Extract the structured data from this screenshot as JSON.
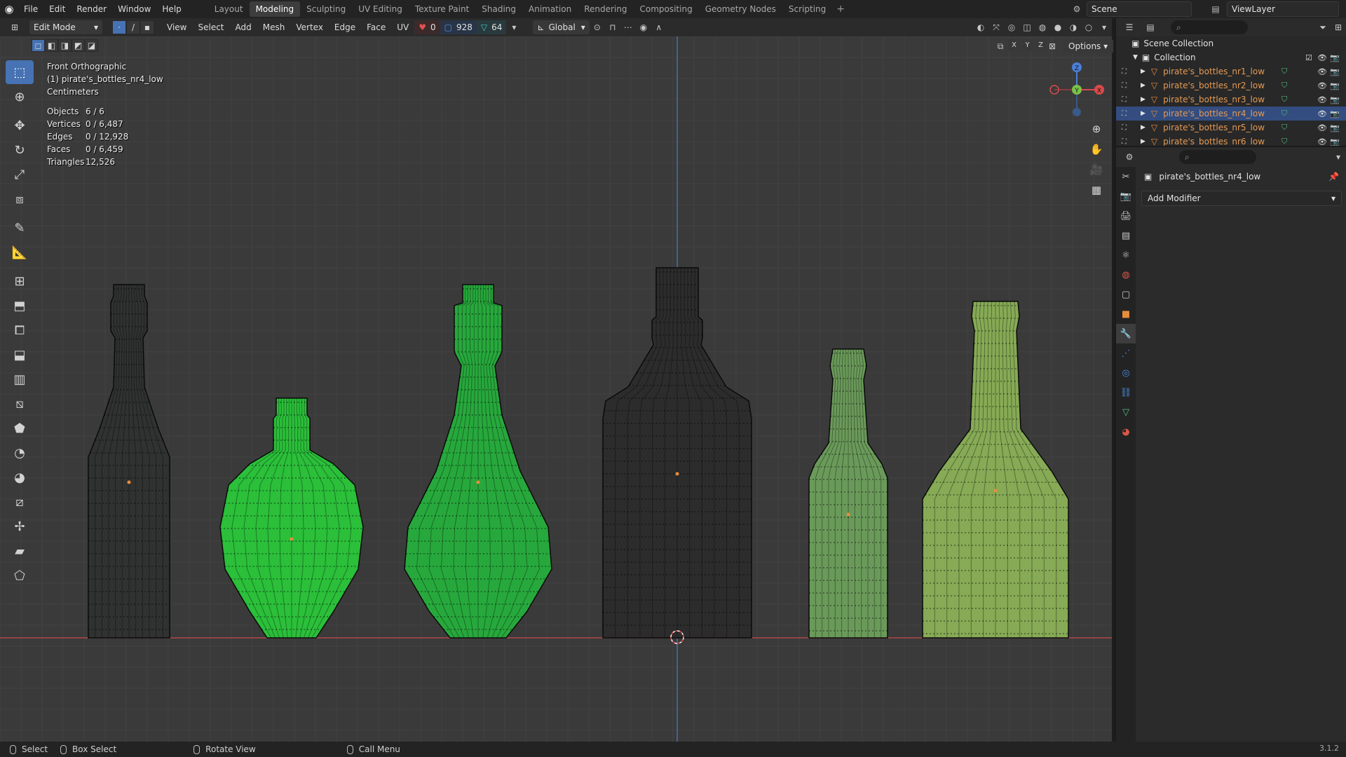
{
  "topbar": {
    "menus": [
      "File",
      "Edit",
      "Render",
      "Window",
      "Help"
    ],
    "workspaces": [
      "Layout",
      "Modeling",
      "Sculpting",
      "UV Editing",
      "Texture Paint",
      "Shading",
      "Animation",
      "Rendering",
      "Compositing",
      "Geometry Nodes",
      "Scripting"
    ],
    "active_workspace": "Modeling",
    "scene": "Scene",
    "view_layer": "ViewLayer"
  },
  "viewport_header": {
    "mode": "Edit Mode",
    "menus": [
      "View",
      "Select",
      "Add",
      "Mesh",
      "Vertex",
      "Edge",
      "Face",
      "UV"
    ],
    "verts_selected": "0",
    "edges_count": "928",
    "faces_count": "64",
    "orientation": "Global",
    "options_label": "Options",
    "axes": [
      "X",
      "Y",
      "Z"
    ]
  },
  "overlay": {
    "view_name": "Front Orthographic",
    "active_object": "(1) pirate's_bottles_nr4_low",
    "units": "Centimeters",
    "stats": [
      {
        "label": "Objects",
        "value": "6 / 6"
      },
      {
        "label": "Vertices",
        "value": "0 / 6,487"
      },
      {
        "label": "Edges",
        "value": "0 / 12,928"
      },
      {
        "label": "Faces",
        "value": "0 / 6,459"
      },
      {
        "label": "Triangles",
        "value": "12,526"
      }
    ]
  },
  "outliner": {
    "scene_collection": "Scene Collection",
    "collection": "Collection",
    "objects": [
      "pirate's_bottles_nr1_low",
      "pirate's_bottles_nr2_low",
      "pirate's_bottles_nr3_low",
      "pirate's_bottles_nr4_low",
      "pirate's_bottles_nr5_low",
      "pirate's_bottles_nr6_low"
    ],
    "selected_index": 3
  },
  "properties": {
    "object_name": "pirate's_bottles_nr4_low",
    "add_modifier": "Add Modifier"
  },
  "statusbar": {
    "select": "Select",
    "box_select": "Box Select",
    "rotate_view": "Rotate View",
    "call_menu": "Call Menu",
    "version": "3.1.2"
  },
  "colors": {
    "accent": "#4772b3",
    "viewport_bg": "#3a3a3a",
    "object_name": "#e49a54",
    "selected_row": "#334d80"
  }
}
